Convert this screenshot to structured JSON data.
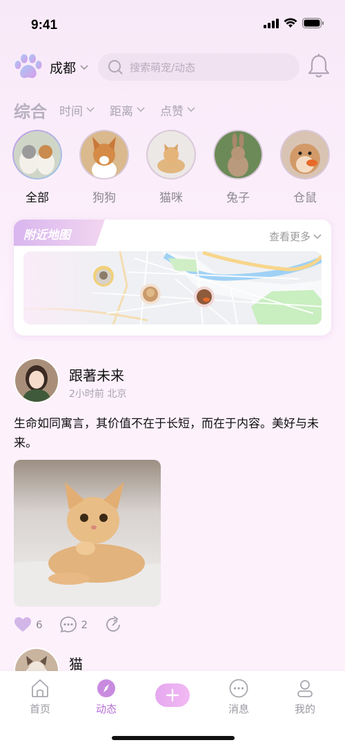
{
  "status": {
    "time": "9:41"
  },
  "header": {
    "city": "成都",
    "search_placeholder": "搜索萌宠/动态"
  },
  "filters": {
    "main": "综合",
    "items": [
      "时间",
      "距离",
      "点赞"
    ]
  },
  "categories": [
    {
      "label": "全部",
      "active": true
    },
    {
      "label": "狗狗",
      "active": false
    },
    {
      "label": "猫咪",
      "active": false
    },
    {
      "label": "兔子",
      "active": false
    },
    {
      "label": "仓鼠",
      "active": false
    }
  ],
  "map": {
    "title": "附近地图",
    "more": "查看更多"
  },
  "post": {
    "username": "跟著未来",
    "meta": "2小时前 北京",
    "text": "生命如同寓言，其价值不在于长短，而在于内容。美好与未来。",
    "likes": "6",
    "comments": "2"
  },
  "post2": {
    "username": "猫咪可爱"
  },
  "tabbar": {
    "home": "首页",
    "feed": "动态",
    "messages": "消息",
    "mine": "我的"
  },
  "colors": {
    "accent": "#b76fd9",
    "background": "#fbeefb"
  }
}
